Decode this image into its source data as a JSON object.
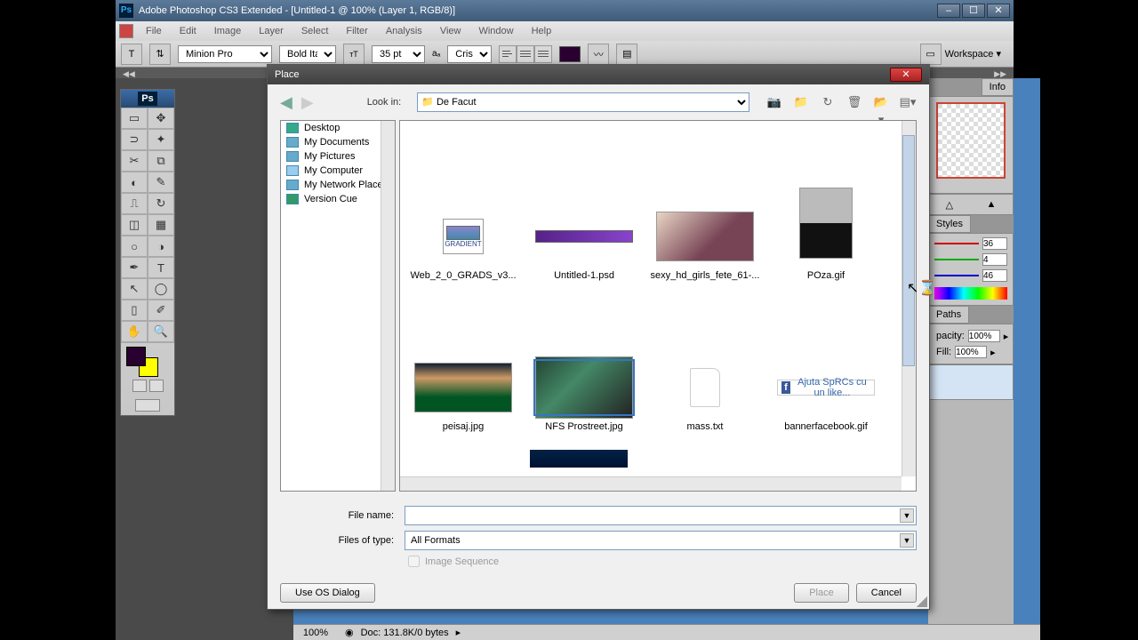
{
  "titlebar": {
    "text": "Adobe Photoshop CS3 Extended - [Untitled-1 @ 100% (Layer 1, RGB/8)]"
  },
  "menubar": {
    "items": [
      "File",
      "Edit",
      "Image",
      "Layer",
      "Select",
      "Filter",
      "Analysis",
      "View",
      "Window",
      "Help"
    ]
  },
  "optbar": {
    "font": "Minion Pro",
    "weight": "Bold Italic",
    "size": "35 pt",
    "aa": "Crisp",
    "workspace": "Workspace ▾"
  },
  "dialog": {
    "title": "Place",
    "lookin_label": "Look in:",
    "lookin_value": "De Facut",
    "tree": [
      "Desktop",
      "My Documents",
      "My Pictures",
      "My Computer",
      "My Network Places",
      "Version Cue"
    ],
    "files": [
      {
        "name": "Web_2_0_GRADS_v3...",
        "type": "grad"
      },
      {
        "name": "Untitled-1.psd",
        "type": "psd"
      },
      {
        "name": "sexy_hd_girls_fete_61-...",
        "type": "girl"
      },
      {
        "name": "POza.gif",
        "type": "car"
      },
      {
        "name": "peisaj.jpg",
        "type": "land"
      },
      {
        "name": "NFS Prostreet.jpg",
        "type": "nfs",
        "sel": true
      },
      {
        "name": "mass.txt",
        "type": "txt"
      },
      {
        "name": "bannerfacebook.gif",
        "type": "fb"
      }
    ],
    "filename_label": "File name:",
    "filename_value": "",
    "filetype_label": "Files of type:",
    "filetype_value": "All Formats",
    "image_seq": "Image Sequence",
    "os_dialog": "Use OS Dialog",
    "place": "Place",
    "cancel": "Cancel",
    "fb_text": "Ajuta SpRCs cu un like..."
  },
  "panels": {
    "info": "Info",
    "styles": "Styles",
    "paths": "Paths",
    "r": "36",
    "g": "4",
    "b": "46",
    "opacity_label": "pacity:",
    "opacity": "100%",
    "fill_label": "Fill:",
    "fill": "100%"
  },
  "status": {
    "zoom": "100%",
    "doc": "Doc: 131.8K/0 bytes"
  }
}
